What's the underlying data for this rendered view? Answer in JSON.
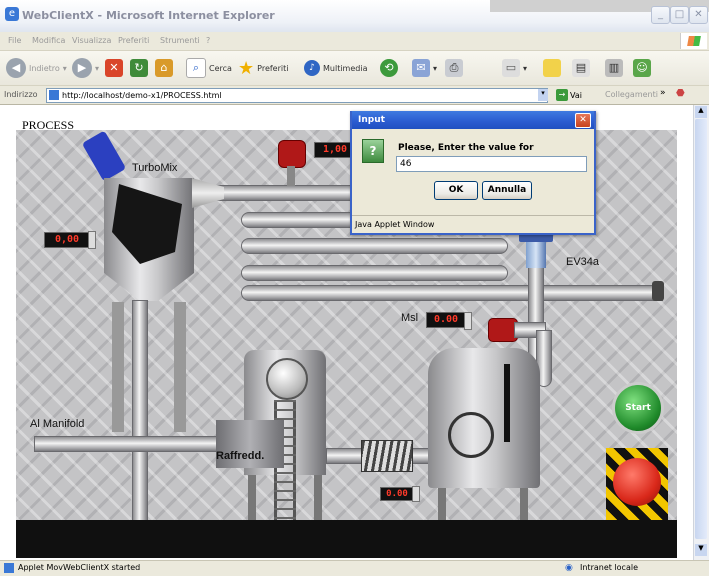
{
  "window": {
    "title": "WebClientX - Microsoft Internet Explorer"
  },
  "menu": {
    "items": [
      "File",
      "Modifica",
      "Visualizza",
      "Preferiti",
      "Strumenti",
      "?"
    ]
  },
  "toolbar": {
    "back": "Indietro",
    "search": "Cerca",
    "favorites": "Preferiti",
    "multimedia": "Multimedia"
  },
  "address": {
    "label": "Indirizzo",
    "url": "http://localhost/demo-x1/PROCESS.html",
    "go": "Vai",
    "links": "Collegamenti"
  },
  "process": {
    "title": "PROCESS",
    "labels": {
      "turbomix": "TurboMix",
      "ev34a": "EV34a",
      "msl": "Msl",
      "manifold": "Al Manifold",
      "raffredd": "Raffredd."
    },
    "displays": {
      "flow": "1,00",
      "turbomix_value": "0,00",
      "msl_value": "0.00",
      "raffredd_value": "0.00"
    },
    "start_button": "Start"
  },
  "dialog": {
    "title": "Input",
    "prompt": "Please, Enter the value for",
    "value": "46",
    "ok": "OK",
    "cancel": "Annulla",
    "footer": "Java Applet Window"
  },
  "status": {
    "text": "Applet MovWebClientX started",
    "zone": "Intranet locale"
  }
}
